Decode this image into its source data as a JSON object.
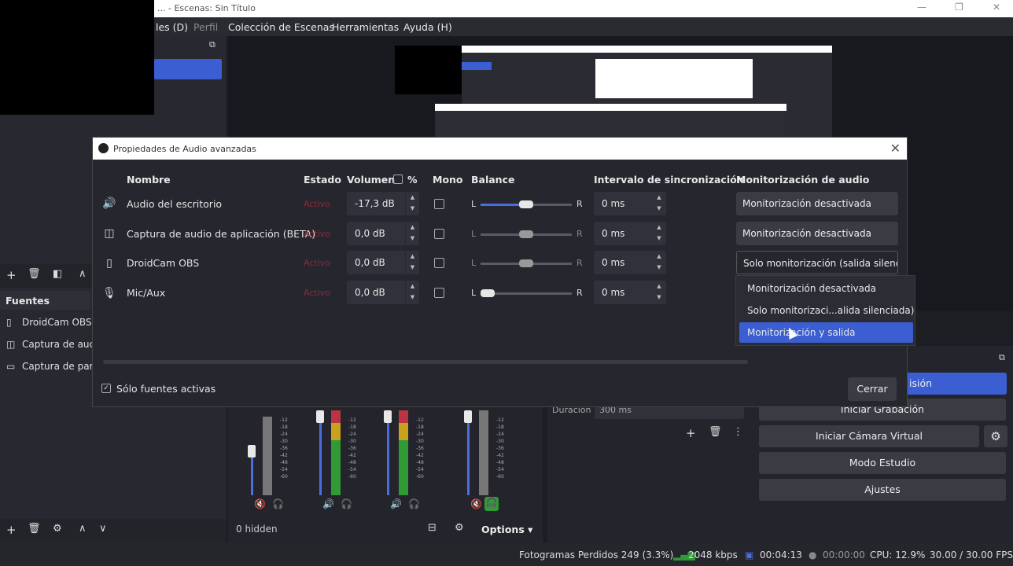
{
  "window": {
    "title": "... - Escenas: Sin Título"
  },
  "menu": [
    "les (D)",
    "Perfil",
    "Colección de Escenas",
    "Herramientas",
    "Ayuda (H)"
  ],
  "sources": {
    "header": "Fuentes",
    "items": [
      "DroidCam OBS",
      "Captura de auc",
      "Captura de par"
    ]
  },
  "dialog": {
    "title": "Propiedades de Audio avanzadas",
    "headers": {
      "name": "Nombre",
      "status": "Estado",
      "volume": "Volumen",
      "percent": "%",
      "mono": "Mono",
      "balance": "Balance",
      "sync": "Intervalo de sincronización",
      "monitoring": "Monitorización de audio"
    },
    "rows": [
      {
        "name": "Audio del escritorio",
        "status": "Activo",
        "volume": "-17,3 dB",
        "bal_l": "L",
        "bal_r": "R",
        "balance": 0.5,
        "sync": "0 ms",
        "monitoring": "Monitorización desactivada"
      },
      {
        "name": "Captura de audio de aplicación (BETA)",
        "status": "Activo",
        "volume": "0,0 dB",
        "bal_l": "L",
        "bal_r": "R",
        "balance": 0.5,
        "sync": "0 ms",
        "monitoring": "Monitorización desactivada"
      },
      {
        "name": "DroidCam OBS",
        "status": "Activo",
        "volume": "0,0 dB",
        "bal_l": "L",
        "bal_r": "R",
        "balance": 0.5,
        "sync": "0 ms",
        "monitoring": "Solo monitorización (salida silencia"
      },
      {
        "name": "Mic/Aux",
        "status": "Activo",
        "volume": "0,0 dB",
        "bal_l": "L",
        "bal_r": "R",
        "balance": 0.0,
        "sync": "0 ms",
        "monitoring": ""
      }
    ],
    "only_active_label": "Sólo fuentes activas",
    "close_label": "Cerrar"
  },
  "dropdown": {
    "options": [
      "Monitorización desactivada",
      "Solo monitorizaci...alida silenciada)",
      "Monitorización y salida"
    ],
    "selected_index": 2
  },
  "controls": {
    "stream_label": "isión",
    "record_label": "Iniciar Grabación",
    "virtual_cam_label": "Iniciar Cámara Virtual",
    "studio_label": "Modo Estudio",
    "settings_label": "Ajustes",
    "duration_label": "Duración",
    "duration_value": "300 ms"
  },
  "mixer": {
    "hidden_label": "0 hidden",
    "options_label": "Options"
  },
  "status": {
    "dropped": "Fotogramas Perdidos 249 (3.3%)",
    "bitrate": "2048 kbps",
    "rec_time": "00:04:13",
    "stream_time": "00:00:00",
    "cpu": "CPU: 12.9%",
    "fps": "30.00 / 30.00 FPS"
  },
  "colors": {
    "accent": "#3b5fd2",
    "status_red": "#8a2a3a",
    "meter_green": "#2f9a36"
  }
}
